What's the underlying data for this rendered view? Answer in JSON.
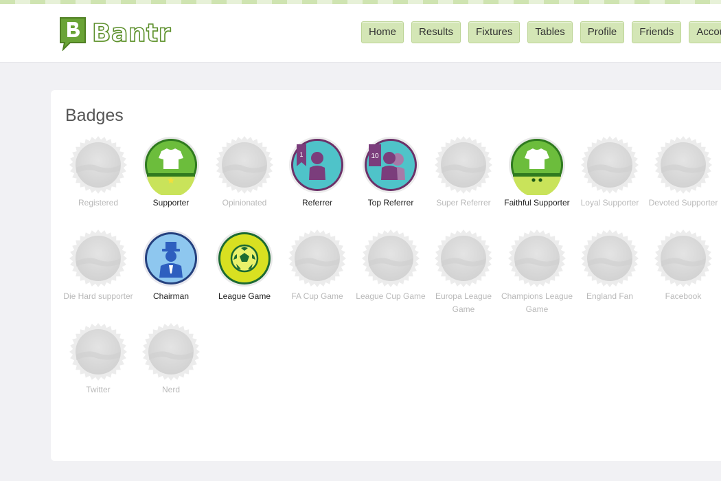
{
  "app": {
    "name": "Bantr"
  },
  "nav": {
    "items": [
      {
        "label": "Home"
      },
      {
        "label": "Results"
      },
      {
        "label": "Fixtures"
      },
      {
        "label": "Tables"
      },
      {
        "label": "Profile"
      },
      {
        "label": "Friends"
      },
      {
        "label": "Accoun"
      }
    ]
  },
  "page": {
    "title": "Badges"
  },
  "badges": [
    {
      "label": "Registered",
      "earned": false,
      "icon": "locked-badge-icon"
    },
    {
      "label": "Supporter",
      "earned": true,
      "icon": "shirt-badge-icon"
    },
    {
      "label": "Opinionated",
      "earned": false,
      "icon": "locked-badge-icon"
    },
    {
      "label": "Referrer",
      "earned": true,
      "icon": "referrer-badge-icon"
    },
    {
      "label": "Top Referrer",
      "earned": true,
      "icon": "top-referrer-badge-icon"
    },
    {
      "label": "Super Referrer",
      "earned": false,
      "icon": "locked-badge-icon"
    },
    {
      "label": "Faithful Supporter",
      "earned": true,
      "icon": "shirt-two-stars-badge-icon"
    },
    {
      "label": "Loyal Supporter",
      "earned": false,
      "icon": "locked-badge-icon"
    },
    {
      "label": "Devoted Supporter",
      "earned": false,
      "icon": "locked-badge-icon"
    },
    {
      "label": "Die Hard supporter",
      "earned": false,
      "icon": "locked-badge-icon"
    },
    {
      "label": "Chairman",
      "earned": true,
      "icon": "chairman-badge-icon"
    },
    {
      "label": "League Game",
      "earned": true,
      "icon": "football-badge-icon"
    },
    {
      "label": "FA Cup Game",
      "earned": false,
      "icon": "locked-badge-icon"
    },
    {
      "label": "League Cup Game",
      "earned": false,
      "icon": "locked-badge-icon"
    },
    {
      "label": "Europa League Game",
      "earned": false,
      "icon": "locked-badge-icon"
    },
    {
      "label": "Champions League Game",
      "earned": false,
      "icon": "locked-badge-icon"
    },
    {
      "label": "England Fan",
      "earned": false,
      "icon": "locked-badge-icon"
    },
    {
      "label": "Facebook",
      "earned": false,
      "icon": "locked-badge-icon"
    },
    {
      "label": "Twitter",
      "earned": false,
      "icon": "locked-badge-icon"
    },
    {
      "label": "Nerd",
      "earned": false,
      "icon": "locked-badge-icon"
    }
  ],
  "colors": {
    "brand_green": "#5c8f2c",
    "nav_button": "#d4e6b6",
    "supporter_green": "#6cbd3c",
    "referrer_teal": "#4fc3c9",
    "referrer_purple": "#7b3d7c",
    "chairman_blue": "#2e5fbf",
    "league_yellow": "#d8e021",
    "locked_grey": "#d8d8d8"
  }
}
